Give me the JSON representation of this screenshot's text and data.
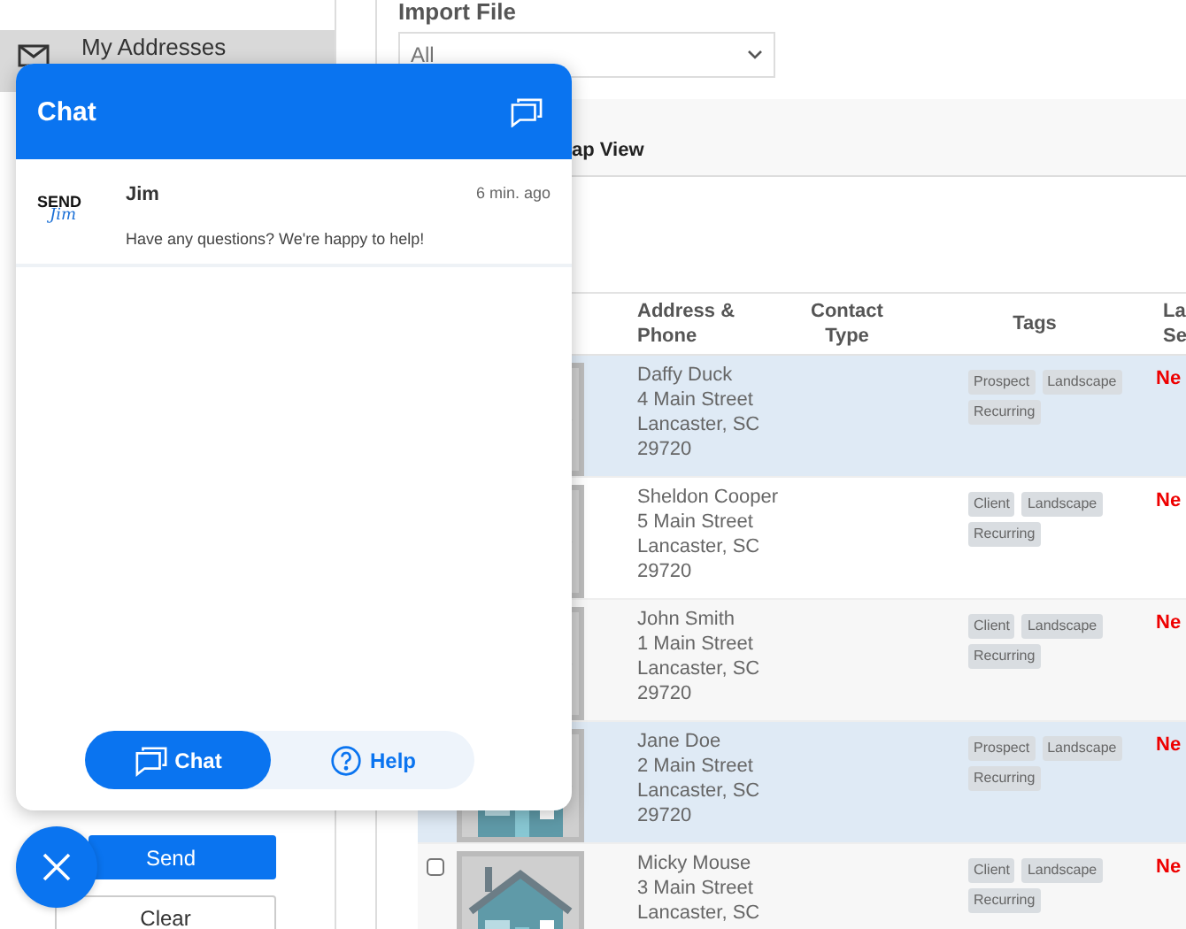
{
  "sidebar": {
    "items": [
      {
        "label": "My Addresses",
        "selected": true
      }
    ],
    "buttons": [
      {
        "label": "Send",
        "kind": "primary"
      },
      {
        "label": "Clear",
        "kind": "secondary"
      }
    ]
  },
  "import_file": {
    "label": "Import File",
    "value": "All"
  },
  "view_tabs": [
    {
      "label": "ap View"
    }
  ],
  "table": {
    "columns": [
      "Address & Phone",
      "Contact Type",
      "Tags",
      "La Se"
    ],
    "rows": [
      {
        "selected": true,
        "name": "Daffy Duck",
        "street": "4 Main Street",
        "city": "Lancaster, SC",
        "zip": "29720",
        "tags": [
          "Prospect",
          "Landscape",
          "Recurring"
        ],
        "status": "Ne"
      },
      {
        "selected": false,
        "name": "Sheldon Cooper",
        "street": "5 Main Street",
        "city": "Lancaster, SC",
        "zip": "29720",
        "tags": [
          "Client",
          "Landscape",
          "Recurring"
        ],
        "status": "Ne"
      },
      {
        "selected": false,
        "name": "John Smith",
        "street": "1 Main Street",
        "city": "Lancaster, SC",
        "zip": "29720",
        "tags": [
          "Client",
          "Landscape",
          "Recurring"
        ],
        "status": "Ne"
      },
      {
        "selected": true,
        "name": "Jane Doe",
        "street": "2 Main Street",
        "city": "Lancaster, SC",
        "zip": "29720",
        "tags": [
          "Prospect",
          "Landscape",
          "Recurring"
        ],
        "status": "Ne"
      },
      {
        "selected": false,
        "checked": false,
        "name": "Micky Mouse",
        "street": "3 Main Street",
        "city": "Lancaster, SC",
        "tags": [
          "Client",
          "Landscape",
          "Recurring"
        ],
        "status": "Ne"
      }
    ]
  },
  "chat": {
    "title": "Chat",
    "messages": [
      {
        "logo_top": "SEND",
        "logo_bottom": "Jim",
        "sender": "Jim",
        "time": "6 min. ago",
        "text": "Have any questions? We're happy to help!"
      }
    ],
    "tabs": [
      {
        "label": "Chat",
        "kind": "chat",
        "selected": true
      },
      {
        "label": "Help",
        "kind": "help",
        "selected": false
      }
    ]
  }
}
